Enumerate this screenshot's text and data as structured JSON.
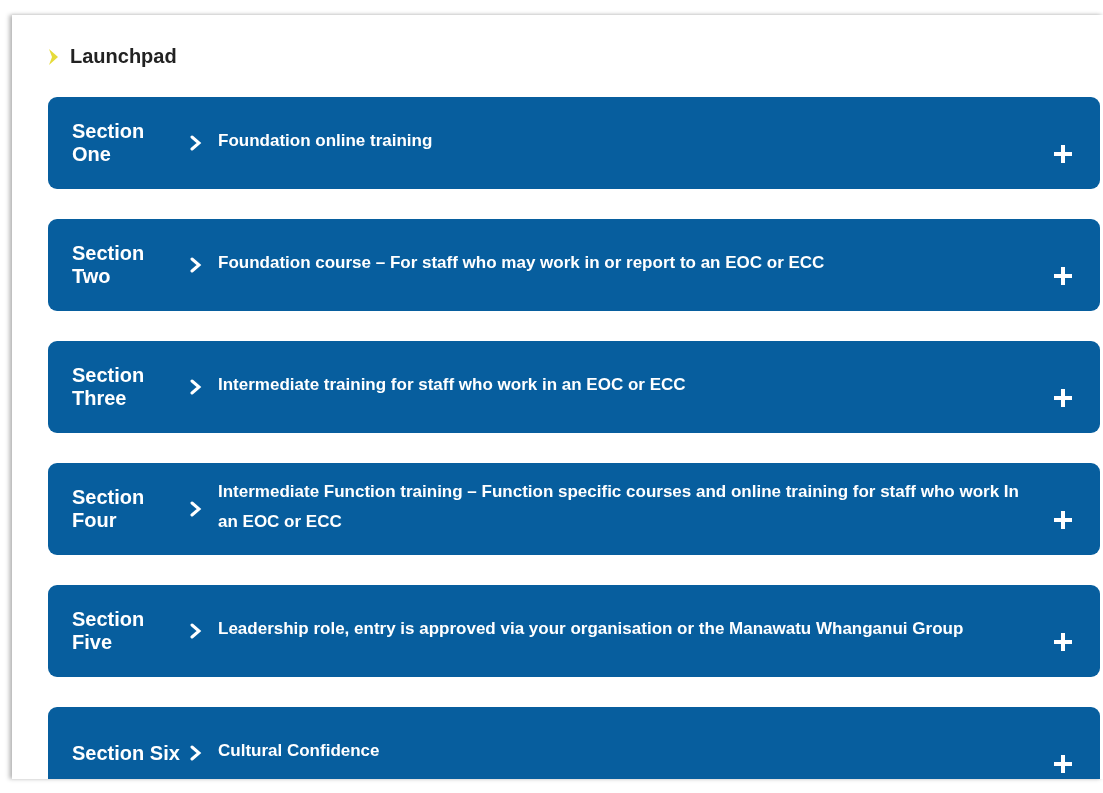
{
  "heading": {
    "title": "Launchpad"
  },
  "sections": [
    {
      "label": "Section One",
      "title": "Foundation online training",
      "expanded": false
    },
    {
      "label": "Section Two",
      "title": "Foundation course – For staff who may work in or report to an EOC or ECC",
      "expanded": false
    },
    {
      "label": "Section Three",
      "title": "Intermediate training for staff who work in an EOC or ECC",
      "expanded": false
    },
    {
      "label": "Section Four",
      "title": "Intermediate Function training – Function specific courses and online training for staff who work In an EOC or ECC",
      "expanded": false
    },
    {
      "label": "Section Five",
      "title": "Leadership role, entry is approved via your organisation or the Manawatu Whanganui Group",
      "expanded": false
    },
    {
      "label": "Section Six",
      "title": "Cultural Confidence",
      "expanded": false
    }
  ]
}
